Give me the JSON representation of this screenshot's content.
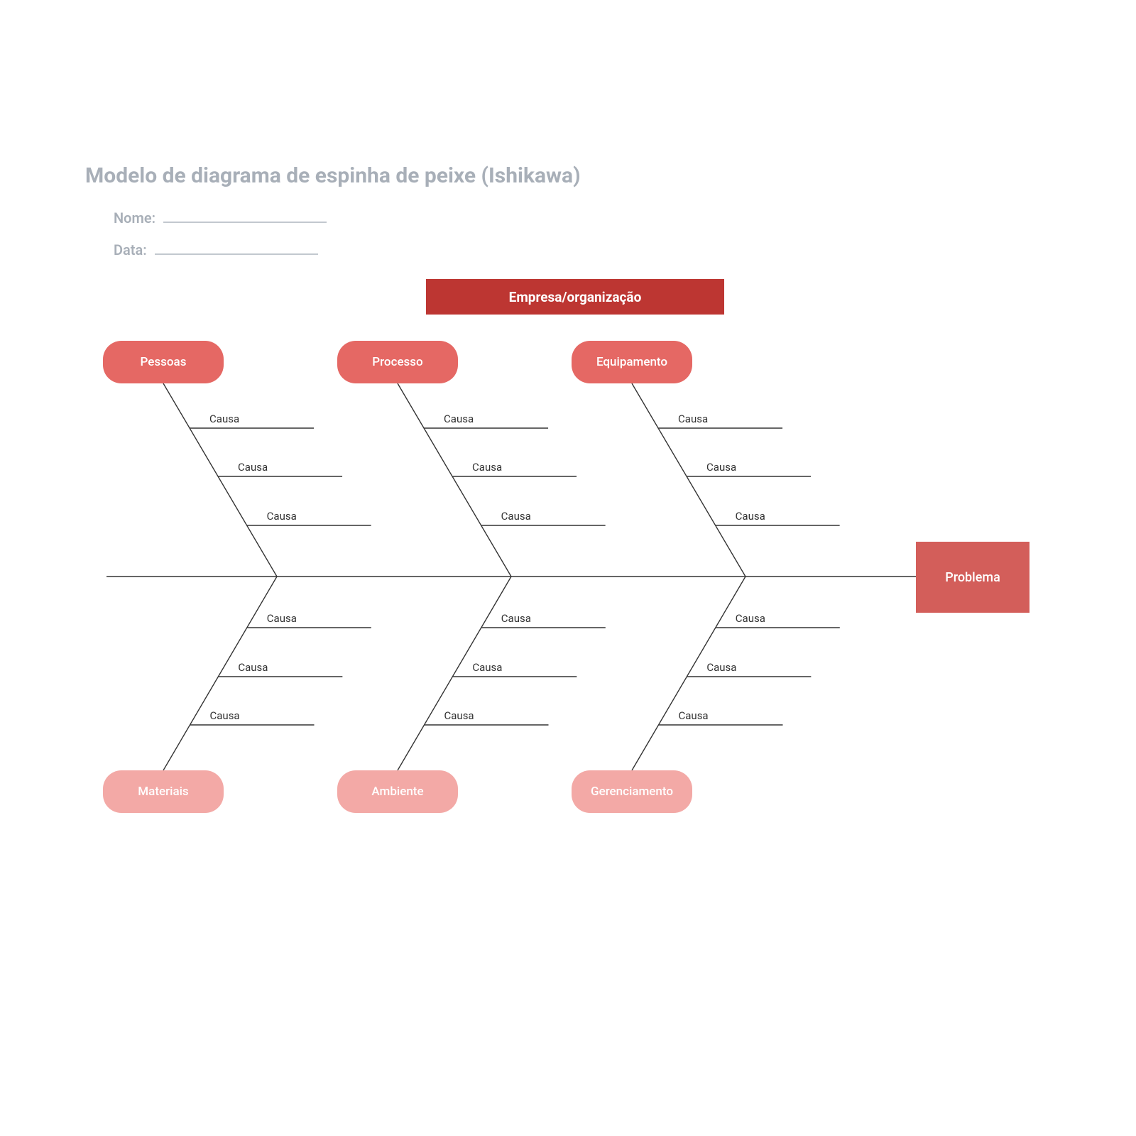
{
  "title": "Modelo de diagrama de espinha de peixe (Ishikawa)",
  "meta": {
    "nome_label": "Nome:",
    "data_label": "Data:"
  },
  "banner": "Empresa/organização",
  "problem": "Problema",
  "categories": {
    "top": [
      "Pessoas",
      "Processo",
      "Equipamento"
    ],
    "bottom": [
      "Materiais",
      "Ambiente",
      "Gerenciamento"
    ]
  },
  "cause_label": "Causa",
  "chart_data": {
    "type": "fishbone",
    "effect": "Problema",
    "context": "Empresa/organização",
    "branches": [
      {
        "name": "Pessoas",
        "side": "top",
        "causes": [
          "Causa",
          "Causa",
          "Causa"
        ]
      },
      {
        "name": "Processo",
        "side": "top",
        "causes": [
          "Causa",
          "Causa",
          "Causa"
        ]
      },
      {
        "name": "Equipamento",
        "side": "top",
        "causes": [
          "Causa",
          "Causa",
          "Causa"
        ]
      },
      {
        "name": "Materiais",
        "side": "bottom",
        "causes": [
          "Causa",
          "Causa",
          "Causa"
        ]
      },
      {
        "name": "Ambiente",
        "side": "bottom",
        "causes": [
          "Causa",
          "Causa",
          "Causa"
        ]
      },
      {
        "name": "Gerenciamento",
        "side": "bottom",
        "causes": [
          "Causa",
          "Causa",
          "Causa"
        ]
      }
    ]
  },
  "geom": {
    "spineY": 812,
    "spineX0": 150,
    "spineX1": 1290,
    "branchTopXs": [
      230,
      560,
      890
    ],
    "branchJoinXs": [
      390,
      720,
      1050
    ],
    "pillTopY": 480,
    "pillBotY": 1085,
    "pillW": 170,
    "pillH": 60,
    "causeTopYs": [
      603,
      671,
      740
    ],
    "causeBotYs": [
      884,
      953,
      1021
    ],
    "causeLineLen": 175
  }
}
